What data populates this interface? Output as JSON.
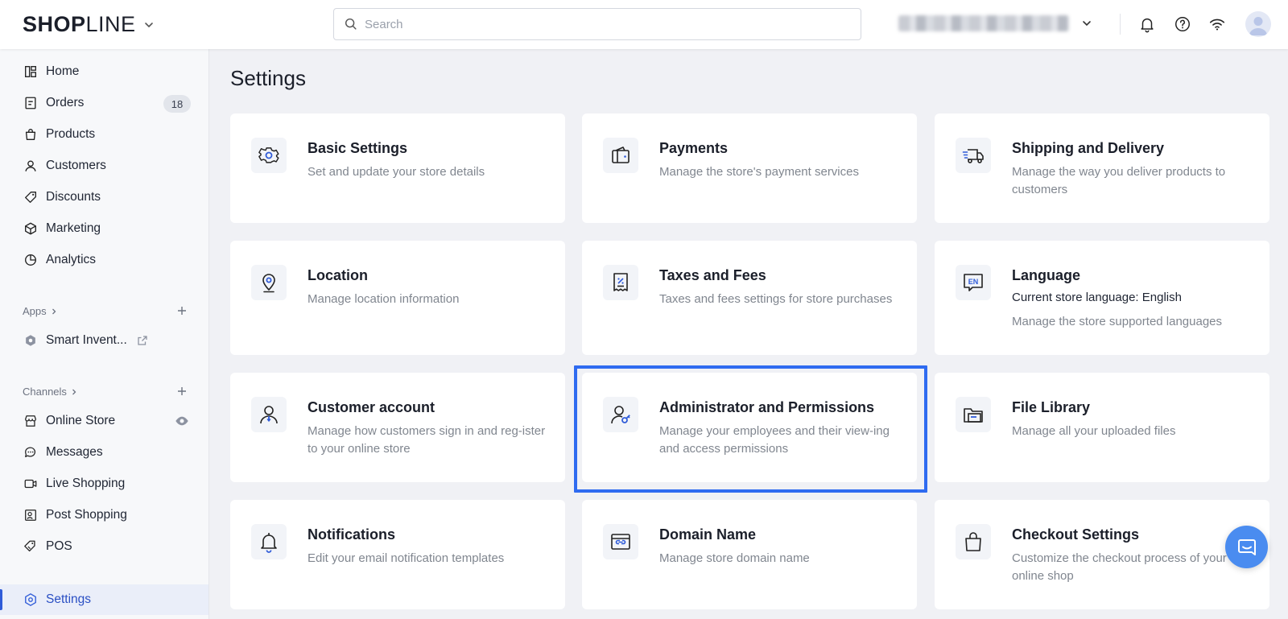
{
  "brand": {
    "logo_bold": "SHOP",
    "logo_light": "LINE"
  },
  "search": {
    "placeholder": "Search",
    "value": ""
  },
  "sidebar": {
    "items": [
      {
        "label": "Home",
        "icon": "home-icon"
      },
      {
        "label": "Orders",
        "icon": "orders-icon",
        "badge": "18"
      },
      {
        "label": "Products",
        "icon": "products-icon"
      },
      {
        "label": "Customers",
        "icon": "customers-icon"
      },
      {
        "label": "Discounts",
        "icon": "discounts-icon"
      },
      {
        "label": "Marketing",
        "icon": "marketing-icon"
      },
      {
        "label": "Analytics",
        "icon": "analytics-icon"
      }
    ],
    "apps_label": "Apps",
    "apps": [
      {
        "label": "Smart Invent...",
        "icon": "smart-inventory-icon"
      }
    ],
    "channels_label": "Channels",
    "channels": [
      {
        "label": "Online Store",
        "icon": "online-store-icon"
      },
      {
        "label": "Messages",
        "icon": "messages-icon"
      },
      {
        "label": "Live Shopping",
        "icon": "live-shopping-icon"
      },
      {
        "label": "Post Shopping",
        "icon": "post-shopping-icon"
      },
      {
        "label": "POS",
        "icon": "pos-icon"
      }
    ],
    "settings": {
      "label": "Settings",
      "icon": "settings-icon"
    }
  },
  "main": {
    "title": "Settings",
    "cards": [
      {
        "title": "Basic Settings",
        "desc": "Set and update your store details",
        "icon": "gear-icon"
      },
      {
        "title": "Payments",
        "desc": "Manage the store's payment services",
        "icon": "wallet-icon"
      },
      {
        "title": "Shipping and Delivery",
        "desc": "Manage the way you deliver products to customers",
        "icon": "truck-icon"
      },
      {
        "title": "Location",
        "desc": "Manage location information",
        "icon": "location-pin-icon"
      },
      {
        "title": "Taxes and Fees",
        "desc": "Taxes and fees settings for store purchases",
        "icon": "receipt-icon"
      },
      {
        "title": "Language",
        "subtitle": "Current store language: English",
        "desc": "Manage the store supported languages",
        "icon": "language-en-icon"
      },
      {
        "title": "Customer account",
        "desc": "Manage how customers sign in and reg-ister to your online store",
        "icon": "customer-account-icon"
      },
      {
        "title": "Administrator and Permissions",
        "desc": "Manage your employees and their view-ing and access permissions",
        "icon": "admin-permissions-icon"
      },
      {
        "title": "File Library",
        "desc": "Manage all your uploaded files",
        "icon": "folder-icon"
      },
      {
        "title": "Notifications",
        "desc": "Edit your email notification templates",
        "icon": "bell-icon"
      },
      {
        "title": "Domain Name",
        "desc": "Manage store domain name",
        "icon": "domain-icon"
      },
      {
        "title": "Checkout Settings",
        "desc": "Customize the checkout process of your online shop",
        "icon": "shopping-bag-icon"
      }
    ]
  },
  "colors": {
    "accent": "#2f5bd8",
    "highlight": "#2f6bf0",
    "chat": "#4a8cf0",
    "background": "#f0f1f5"
  }
}
